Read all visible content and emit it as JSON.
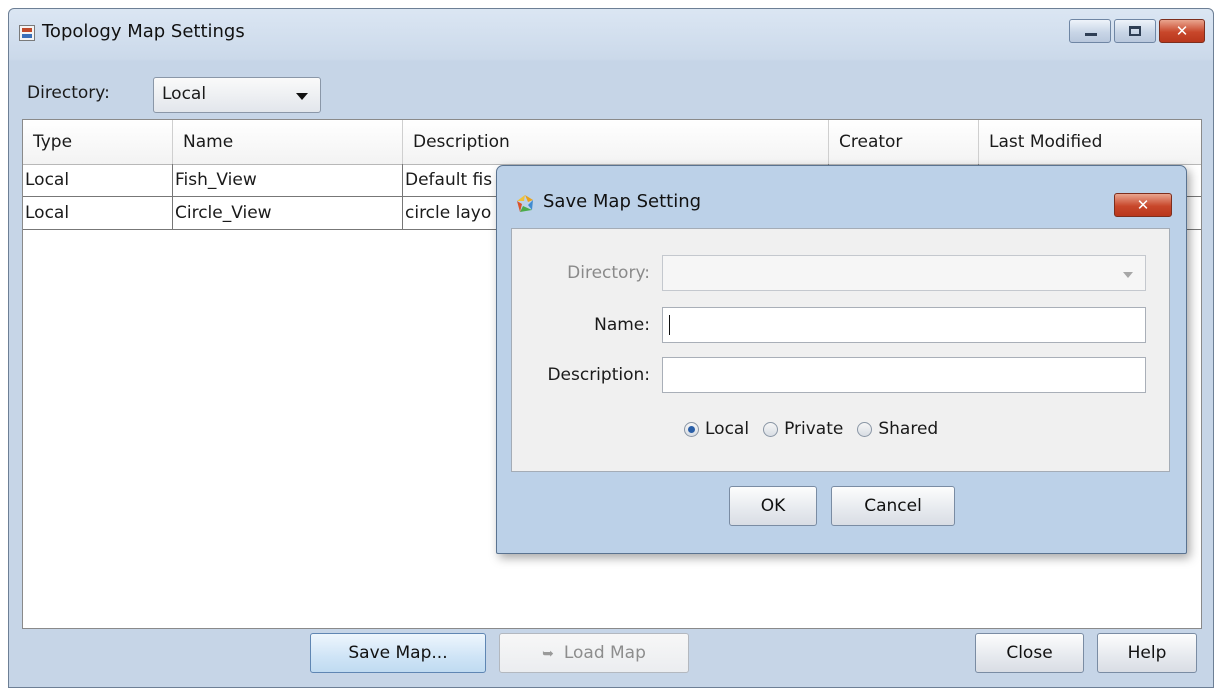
{
  "main_window": {
    "title": "Topology Map Settings",
    "directory_label": "Directory:",
    "directory_value": "Local",
    "table": {
      "columns": [
        "Type",
        "Name",
        "Description",
        "Creator",
        "Last Modified"
      ],
      "rows": [
        [
          "Local",
          "Fish_View",
          "Default fis",
          "",
          ""
        ],
        [
          "Local",
          "Circle_View",
          "circle layo",
          "",
          ""
        ]
      ]
    },
    "buttons": {
      "save_map": "Save Map...",
      "load_map": "Load Map",
      "close": "Close",
      "help": "Help"
    }
  },
  "dialog": {
    "title": "Save Map Setting",
    "directory_label": "Directory:",
    "directory_value": "",
    "name_label": "Name:",
    "name_value": "",
    "description_label": "Description:",
    "description_value": "",
    "radio_options": [
      "Local",
      "Private",
      "Shared"
    ],
    "radio_selected": "Local",
    "ok": "OK",
    "cancel": "Cancel"
  },
  "colors": {
    "window_frame": "#c6d5e7",
    "close_button": "#c8472b",
    "primary_button": "#cfe4f6",
    "radio_selected": "#2a5fa8"
  }
}
